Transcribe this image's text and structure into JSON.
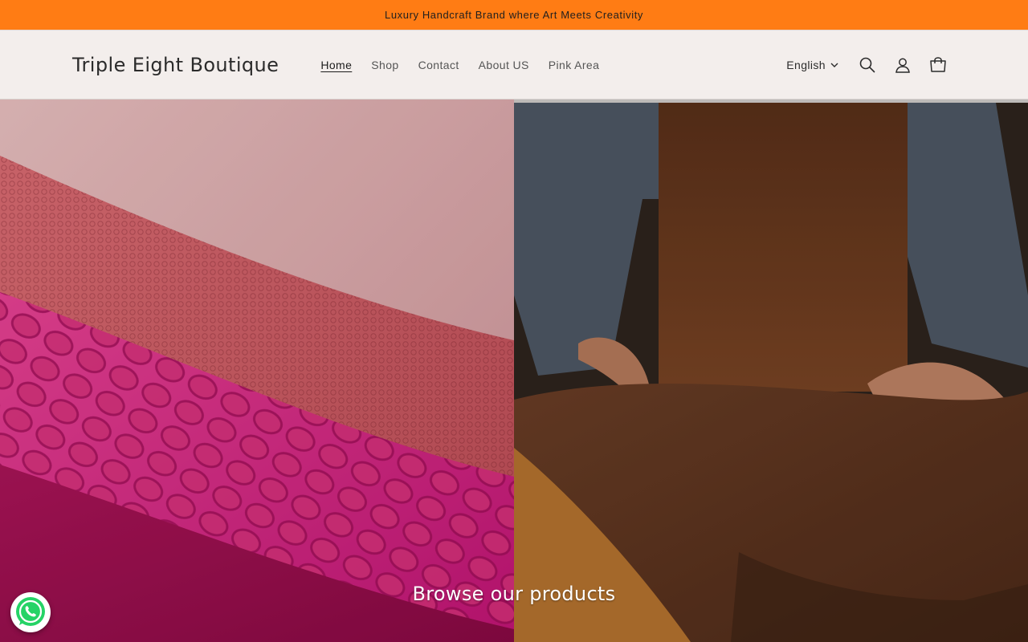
{
  "announcement": {
    "text": "Luxury Handcraft Brand where Art Meets Creativity"
  },
  "header": {
    "brand": "Triple Eight Boutique",
    "nav": [
      {
        "label": "Home",
        "active": true
      },
      {
        "label": "Shop",
        "active": false
      },
      {
        "label": "Contact",
        "active": false
      },
      {
        "label": "About US",
        "active": false
      },
      {
        "label": "Pink Area",
        "active": false
      }
    ],
    "language": "English",
    "icons": [
      "chevron-down-icon",
      "search-icon",
      "account-icon",
      "cart-icon"
    ]
  },
  "hero": {
    "caption": "Browse our products"
  },
  "colors": {
    "announcement_bg": "#ff7c14",
    "header_bg": "#f3eeec",
    "text": "#2b2b2b",
    "whatsapp_green": "#25d366"
  },
  "floating": {
    "icon": "whatsapp-icon"
  }
}
